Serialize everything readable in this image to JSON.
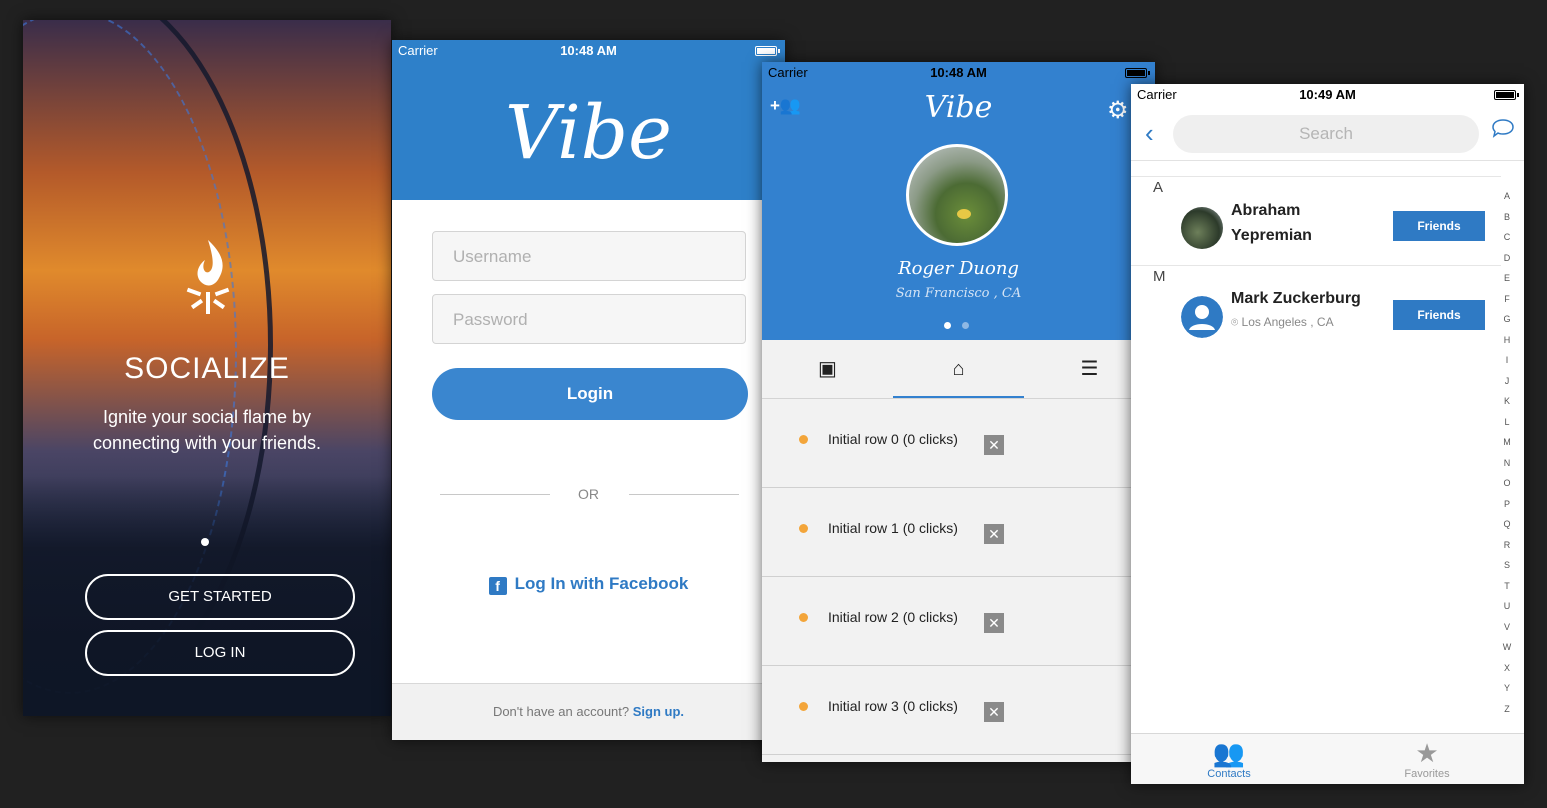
{
  "screen1": {
    "brand": "SOCIALIZE",
    "tagline": "Ignite your social flame by connecting with your friends.",
    "get_started": "GET STARTED",
    "log_in": "LOG IN"
  },
  "screen2": {
    "status": {
      "carrier": "Carrier",
      "time": "10:48 AM"
    },
    "logo": "Vibe",
    "username_placeholder": "Username",
    "password_placeholder": "Password",
    "login": "Login",
    "or": "OR",
    "facebook": "Log In with Facebook",
    "no_account": "Don't have an account?",
    "sign_up": "Sign up."
  },
  "screen3": {
    "status": {
      "carrier": "Carrier",
      "time": "10:48 AM"
    },
    "title": "Vibe",
    "add_friend_icon": "+👥",
    "profile_name": "Roger Duong",
    "profile_location": "San Francisco , CA",
    "rows": [
      {
        "text": "Initial row 0 (0 clicks)"
      },
      {
        "text": "Initial row 1 (0 clicks)"
      },
      {
        "text": "Initial row 2 (0 clicks)"
      },
      {
        "text": "Initial row 3 (0 clicks)"
      }
    ],
    "close_glyph": "✕"
  },
  "screen4": {
    "status": {
      "carrier": "Carrier",
      "time": "10:49 AM"
    },
    "search_placeholder": "Search",
    "sections": [
      {
        "letter": "A",
        "name_line1": "Abraham",
        "name_line2": "Yepremian",
        "button": "Friends"
      },
      {
        "letter": "M",
        "name": "Mark Zuckerburg",
        "location": "Los Angeles , CA",
        "button": "Friends"
      }
    ],
    "index_letters": [
      "A",
      "B",
      "C",
      "D",
      "E",
      "F",
      "G",
      "H",
      "I",
      "J",
      "K",
      "L",
      "M",
      "N",
      "O",
      "P",
      "Q",
      "R",
      "S",
      "T",
      "U",
      "V",
      "W",
      "X",
      "Y",
      "Z"
    ],
    "tabs": {
      "contacts": "Contacts",
      "favorites": "Favorites"
    }
  },
  "colors": {
    "primary_blue": "#2e80c9",
    "accent_orange": "#f3a53a",
    "background": "#212121"
  }
}
